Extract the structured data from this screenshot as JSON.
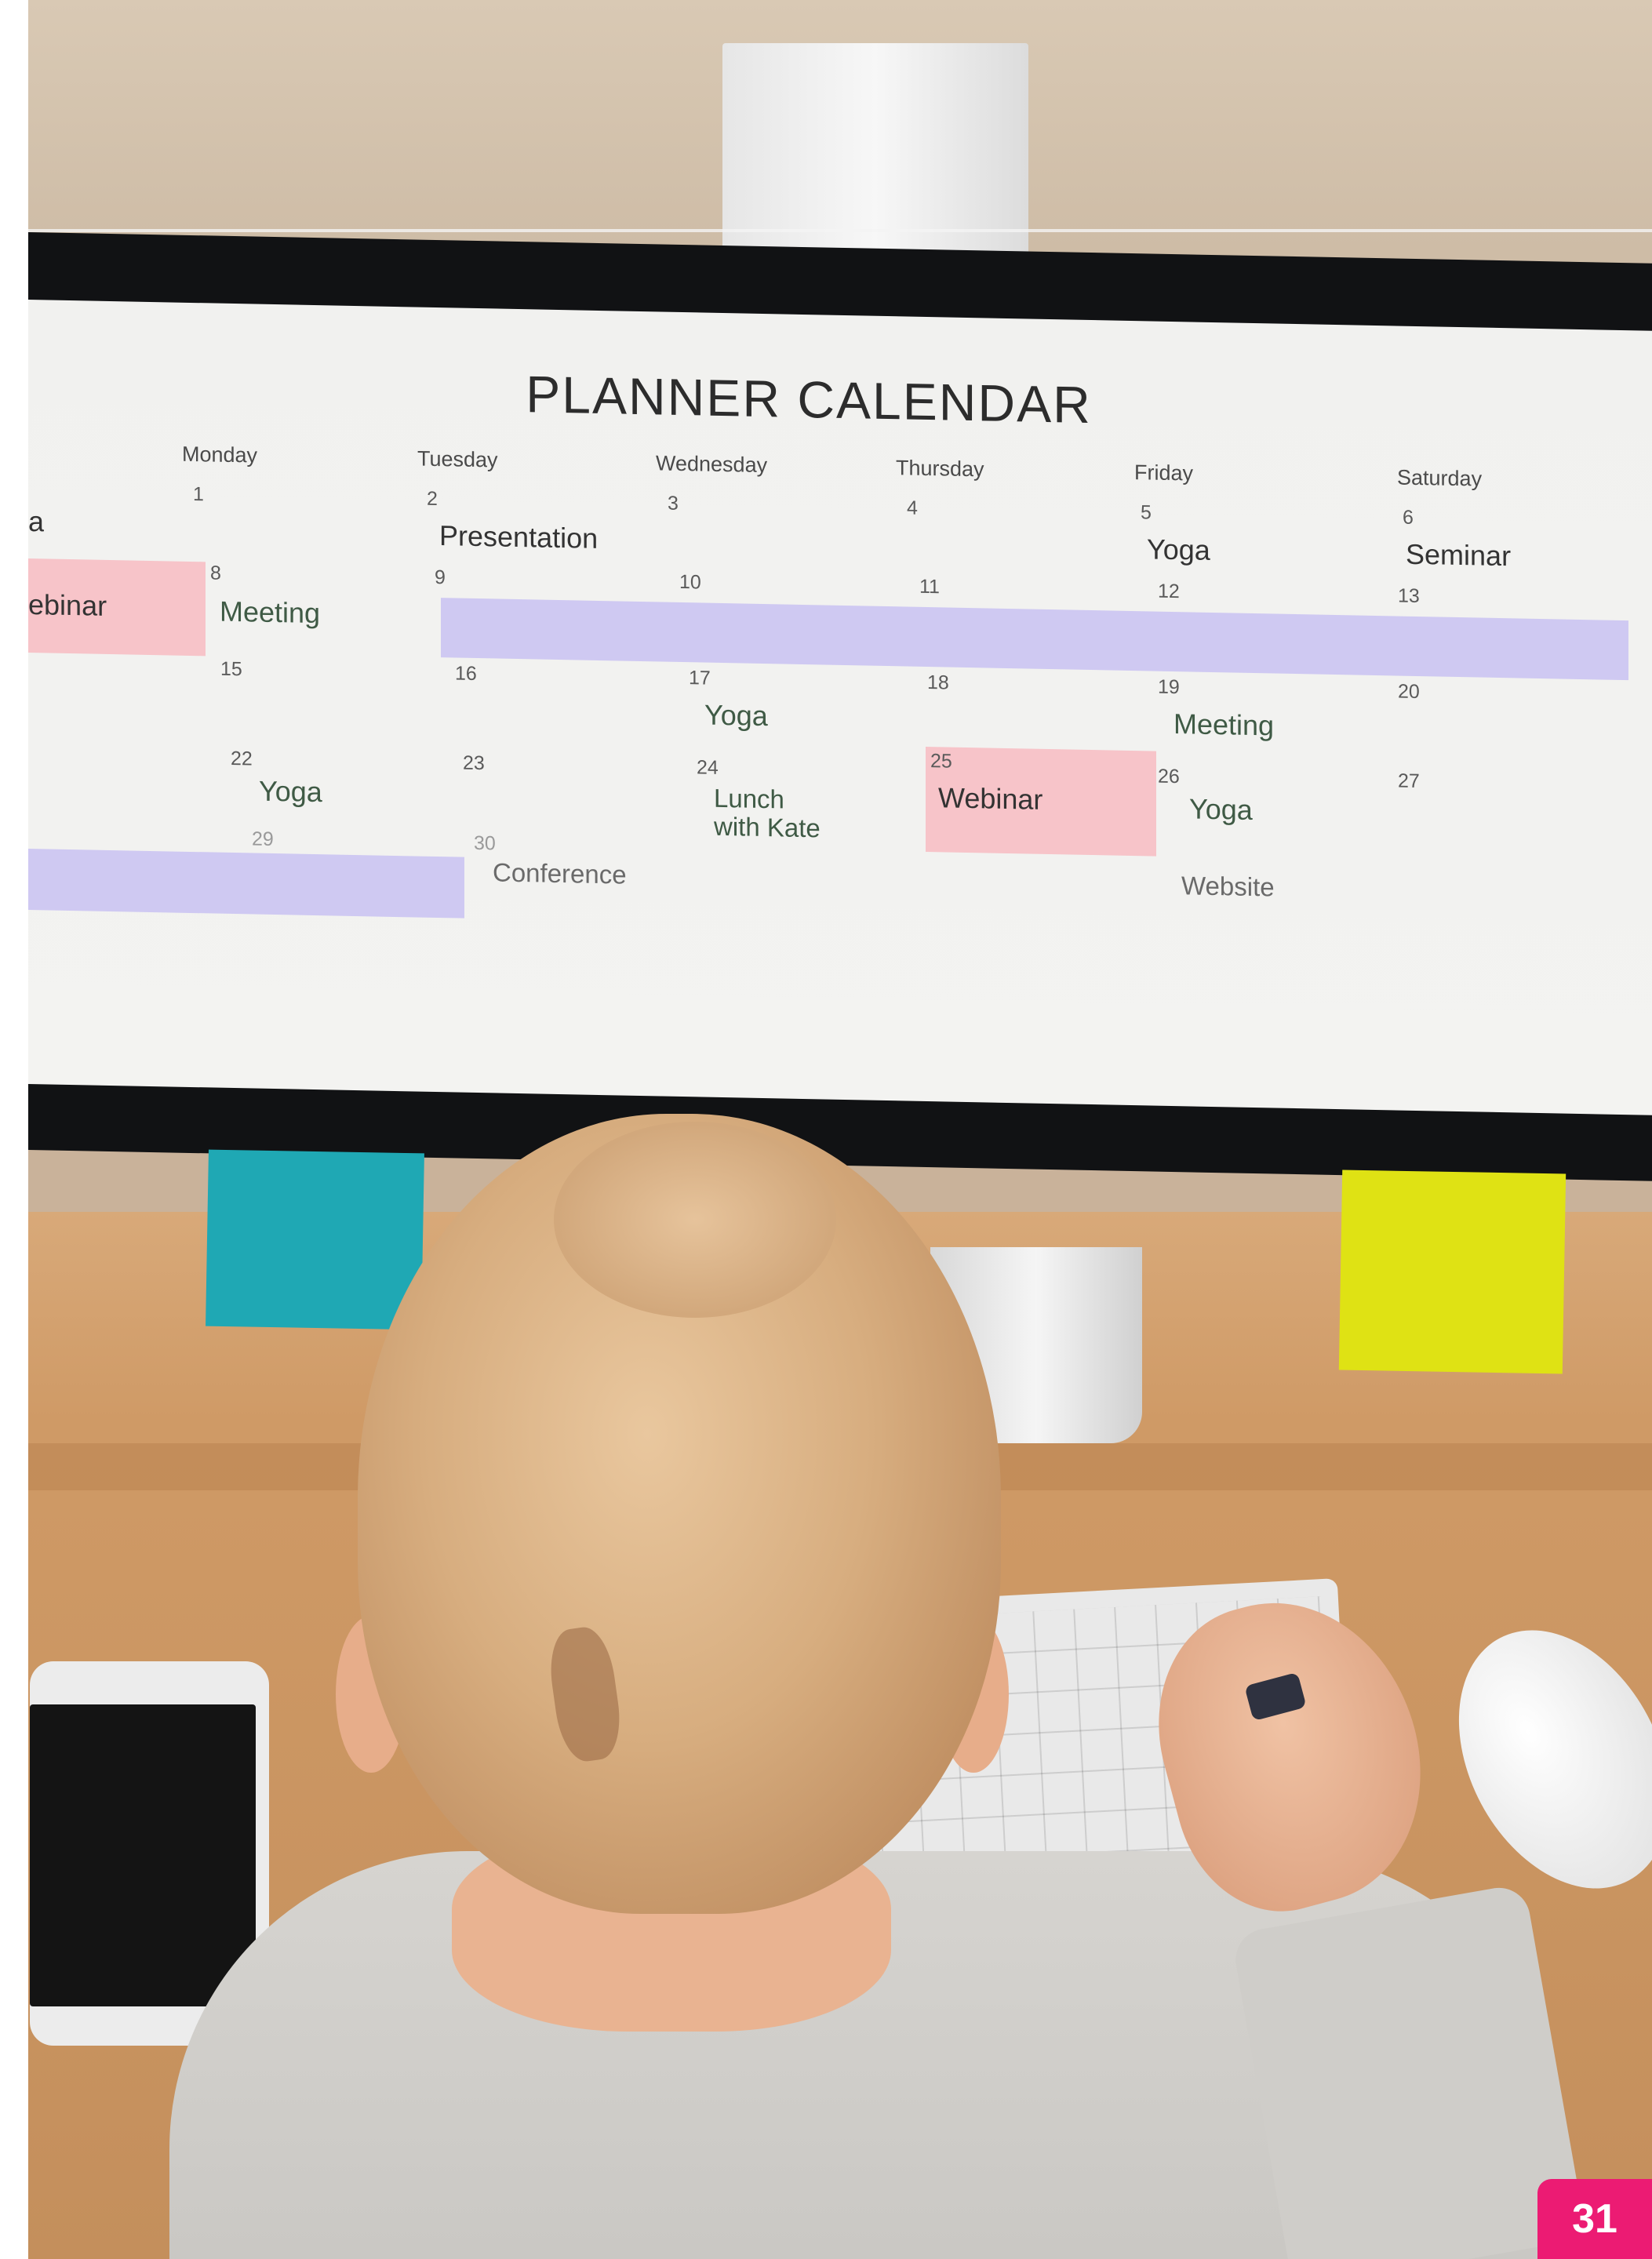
{
  "calendar": {
    "title": "PLANNER CALENDAR",
    "day_names": [
      "Monday",
      "Tuesday",
      "Wednesday",
      "Thursday",
      "Friday",
      "Saturday"
    ],
    "dates": {
      "d1": "1",
      "d2": "2",
      "d3": "3",
      "d4": "4",
      "d5": "5",
      "d6": "6",
      "d8": "8",
      "d9": "9",
      "d10": "10",
      "d11": "11",
      "d12": "12",
      "d13": "13",
      "d15": "15",
      "d16": "16",
      "d17": "17",
      "d18": "18",
      "d19": "19",
      "d20": "20",
      "d22": "22",
      "d23": "23",
      "d24": "24",
      "d25": "25",
      "d26": "26",
      "d27": "27",
      "d29": "29",
      "d30": "30"
    },
    "events": {
      "clipped_a": "a",
      "presentation": "Presentation",
      "yoga_fri_5": "Yoga",
      "seminar": "Seminar",
      "webinar_clipped": "ebinar",
      "meeting_mon": "Meeting",
      "yoga_wed_17": "Yoga",
      "meeting_fri_19": "Meeting",
      "yoga_mon_22": "Yoga",
      "lunch_line1": "Lunch",
      "lunch_line2": "with Kate",
      "webinar_thu_25": "Webinar",
      "yoga_fri_26": "Yoga",
      "conference": "Conference",
      "website": "Website"
    }
  },
  "page_number": "31",
  "colors": {
    "pink_block": "#f7c4c9",
    "lavender_block": "#cfc9f2",
    "badge": "#ec1b73",
    "sticky_blue": "#1fa8b4",
    "sticky_yellow": "#dfe214"
  }
}
